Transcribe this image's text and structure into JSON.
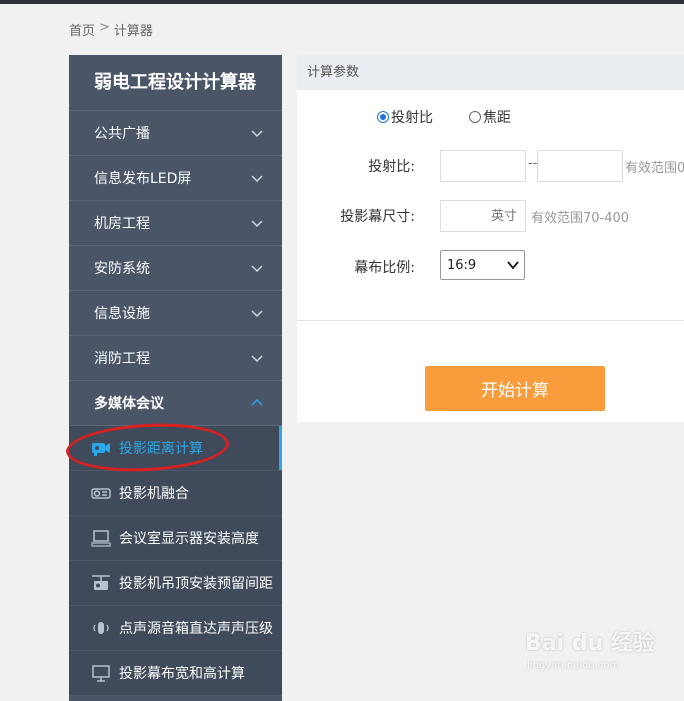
{
  "breadcrumb": {
    "home": "首页",
    "separator": ">",
    "current": "计算器"
  },
  "sidebar": {
    "title": "弱电工程设计计算器",
    "categories": [
      {
        "label": "公共广播",
        "state": "collapsed"
      },
      {
        "label": "信息发布LED屏",
        "state": "collapsed"
      },
      {
        "label": "机房工程",
        "state": "collapsed"
      },
      {
        "label": "安防系统",
        "state": "collapsed"
      },
      {
        "label": "信息设施",
        "state": "collapsed"
      },
      {
        "label": "消防工程",
        "state": "collapsed"
      },
      {
        "label": "多媒体会议",
        "state": "expanded"
      }
    ],
    "sub_items": [
      {
        "label": "投影距离计算",
        "icon": "camera-icon",
        "active": true
      },
      {
        "label": "投影机融合",
        "icon": "projector-icon",
        "active": false
      },
      {
        "label": "会议室显示器安装高度",
        "icon": "monitor-icon",
        "active": false
      },
      {
        "label": "投影机吊顶安装预留间距",
        "icon": "ceiling-projector-icon",
        "active": false
      },
      {
        "label": "点声源音箱直达声声压级",
        "icon": "speaker-icon",
        "active": false
      },
      {
        "label": "投影幕布宽和高计算",
        "icon": "screen-icon",
        "active": false
      }
    ]
  },
  "panel": {
    "header": "计算参数",
    "radio_options": [
      {
        "label": "投射比",
        "checked": true
      },
      {
        "label": "焦距",
        "checked": false
      }
    ],
    "ratio": {
      "label": "投射比:",
      "dash": "--",
      "hint": "有效范围0"
    },
    "screen_size": {
      "label": "投影幕尺寸:",
      "placeholder": "英寸",
      "hint": "有效范围70-400"
    },
    "aspect": {
      "label": "幕布比例:",
      "selected": "16:9"
    },
    "calc_button": "开始计算"
  },
  "watermark": {
    "brand": "Bai du 经验",
    "url": "jingyan.baidu.com"
  },
  "colors": {
    "sidebar_bg": "#4a5668",
    "active_blue": "#2ba8e8",
    "button_orange": "#f89c3c",
    "annotation_red": "#d9211f"
  }
}
